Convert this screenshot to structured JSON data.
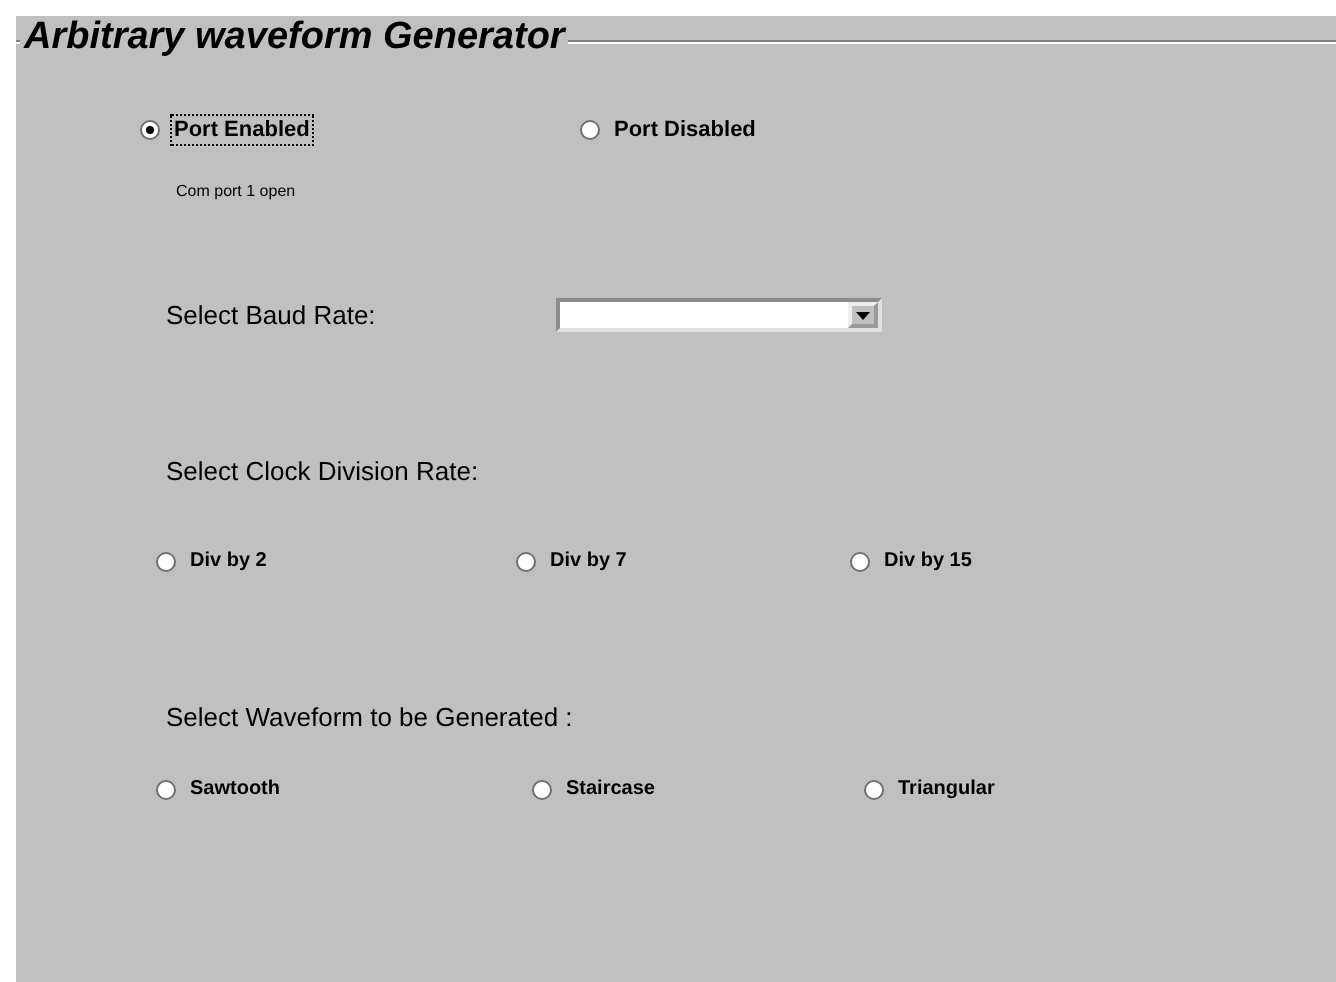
{
  "title": "Arbitrary waveform Generator",
  "port_options": [
    {
      "label": "Port Enabled",
      "selected": true
    },
    {
      "label": "Port Disabled",
      "selected": false
    }
  ],
  "status": "Com port 1 open",
  "baud_rate": {
    "label": "Select Baud Rate:"
  },
  "clock_division": {
    "label": "Select Clock Division Rate:",
    "options": [
      {
        "label": "Div by 2",
        "selected": false
      },
      {
        "label": "Div by 7",
        "selected": false
      },
      {
        "label": "Div by 15",
        "selected": false
      }
    ]
  },
  "waveform": {
    "label": "Select Waveform to be Generated :",
    "options": [
      {
        "label": "Sawtooth",
        "selected": false
      },
      {
        "label": "Staircase",
        "selected": false
      },
      {
        "label": "Triangular",
        "selected": false
      }
    ]
  }
}
